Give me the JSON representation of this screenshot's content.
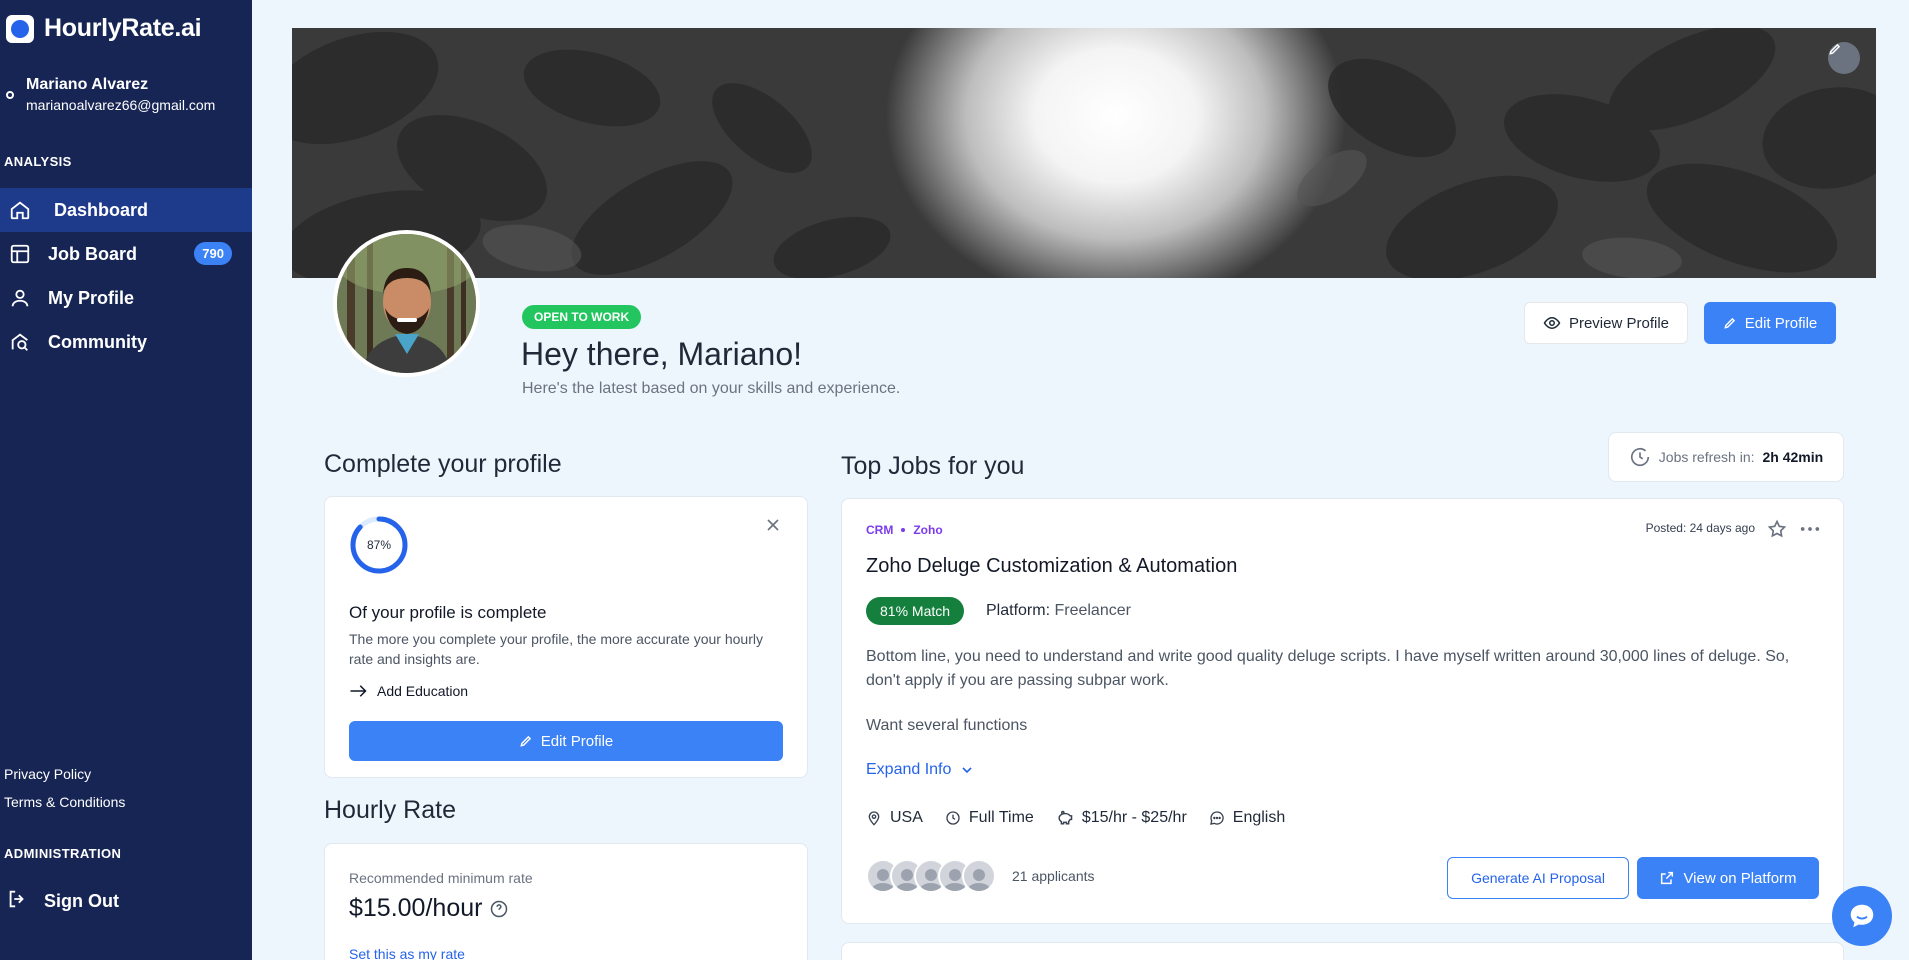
{
  "brand": {
    "name": "HourlyRate.ai"
  },
  "user": {
    "name": "Mariano Alvarez",
    "email": "marianoalvarez66@gmail.com"
  },
  "sidebar": {
    "analysis_label": "ANALYSIS",
    "items": [
      {
        "label": "Dashboard",
        "icon": "home-icon",
        "active": true
      },
      {
        "label": "Job Board",
        "icon": "job-board-icon",
        "badge": "790"
      },
      {
        "label": "My Profile",
        "icon": "user-icon"
      },
      {
        "label": "Community",
        "icon": "community-icon"
      }
    ],
    "privacy": "Privacy Policy",
    "terms": "Terms & Conditions",
    "admin_label": "ADMINISTRATION",
    "signout": "Sign Out"
  },
  "profile": {
    "status_badge": "OPEN TO WORK",
    "greeting": "Hey there, Mariano!",
    "subtitle": "Here's the latest based on your skills and experience.",
    "preview_label": "Preview Profile",
    "edit_label": "Edit Profile"
  },
  "complete_profile": {
    "heading": "Complete your profile",
    "percent": 87,
    "percent_label": "87%",
    "title": "Of your profile is complete",
    "description": "The more you complete your profile, the more accurate your hourly rate and insights are.",
    "next_step": "Add Education",
    "button": "Edit Profile"
  },
  "hourly_rate": {
    "heading": "Hourly Rate",
    "label": "Recommended minimum rate",
    "value": "$15.00/hour",
    "link": "Set this as my rate"
  },
  "jobs": {
    "heading": "Top Jobs for you",
    "refresh_label": "Jobs refresh in:",
    "refresh_value": "2h 42min",
    "job": {
      "tag1": "CRM",
      "tag2": "Zoho",
      "posted": "Posted: 24 days ago",
      "title": "Zoho Deluge Customization & Automation",
      "match": "81% Match",
      "platform_label": "Platform:",
      "platform_value": "Freelancer",
      "description": "Bottom line, you need to understand and write good quality deluge scripts. I have myself written around 30,000 lines of deluge. So, don't apply if you are passing subpar work.",
      "description2": "Want several functions",
      "expand": "Expand Info",
      "location": "USA",
      "type": "Full Time",
      "rate": "$15/hr - $25/hr",
      "language": "English",
      "applicants": "21 applicants",
      "proposal_button": "Generate AI Proposal",
      "view_button": "View on Platform"
    }
  },
  "colors": {
    "sidebar": "#172554",
    "accent": "#3b82f6",
    "success": "#22c55e",
    "match": "#15803d",
    "tag": "#7c3aed"
  }
}
